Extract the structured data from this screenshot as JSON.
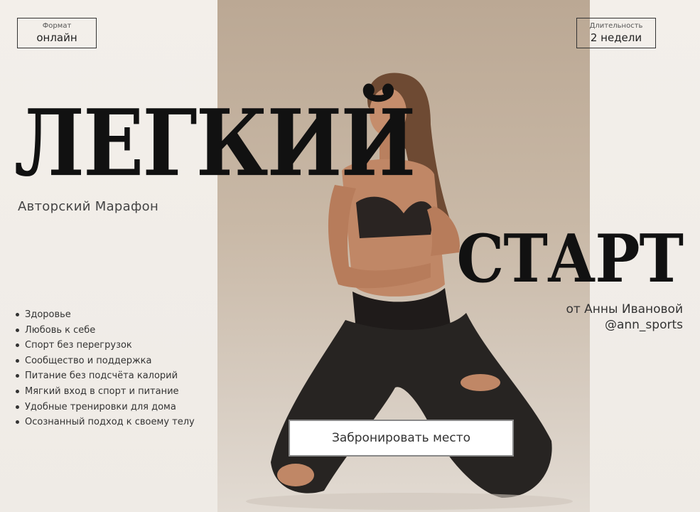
{
  "format": {
    "label": "Формат",
    "value": "онлайн"
  },
  "duration": {
    "label": "Длительность",
    "value": "2 недели"
  },
  "title": {
    "line1": "ЛЕГКИЙ",
    "line2": "СТАРТ"
  },
  "subtitle": "Авторский Марафон",
  "author": {
    "by": "от Анны Ивановой",
    "handle": "@ann_sports"
  },
  "features": [
    "Здоровье",
    "Любовь к себе",
    "Спорт без перегрузок",
    "Сообщество и поддержка",
    "Питание без подсчёта калорий",
    "Мягкий вход в спорт и питание",
    "Удобные тренировки для дома",
    "Осознанный подход к своему телу"
  ],
  "cta": {
    "label": "Забронировать место"
  }
}
